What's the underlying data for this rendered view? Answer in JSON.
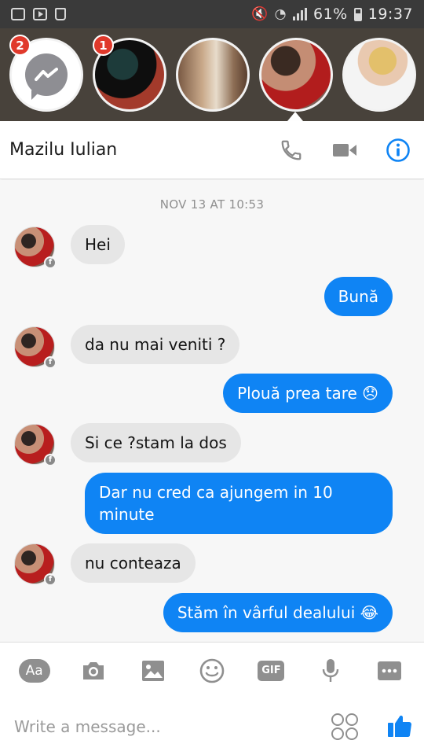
{
  "status_bar": {
    "battery": "61%",
    "time": "19:37",
    "left_icons": [
      "gallery-icon",
      "youtube-icon",
      "recycle-icon"
    ],
    "right_icons": [
      "mute-icon",
      "wifi-icon",
      "signal-icon",
      "battery-icon"
    ]
  },
  "chat_heads": [
    {
      "name": "messenger",
      "badge": "2"
    },
    {
      "name": "contact-1",
      "badge": "1"
    },
    {
      "name": "contact-2",
      "badge": ""
    },
    {
      "name": "contact-3",
      "badge": ""
    },
    {
      "name": "contact-4",
      "badge": ""
    }
  ],
  "header": {
    "title": "Mazilu Iulian",
    "icons": [
      "phone-icon",
      "video-camera-icon",
      "info-icon"
    ]
  },
  "conversation": {
    "timestamp": "NOV 13 AT 10:53",
    "messages": [
      {
        "from": "them",
        "text": "Hei"
      },
      {
        "from": "me",
        "text": "Bună"
      },
      {
        "from": "them",
        "text": "da nu mai veniti ?"
      },
      {
        "from": "me",
        "text": "Plouă prea tare 😞"
      },
      {
        "from": "them",
        "text": "Si ce ?stam la dos"
      },
      {
        "from": "me",
        "text": "Dar nu cred ca ajungem in 10 minute"
      },
      {
        "from": "them",
        "text": "nu conteaza"
      },
      {
        "from": "me",
        "text": "Stăm în vârful dealului 😂"
      }
    ]
  },
  "toolbar": {
    "aa_label": "Aa",
    "gif_label": "GIF",
    "icons": [
      "text-style-icon",
      "camera-icon",
      "image-icon",
      "smiley-icon",
      "gif-icon",
      "microphone-icon",
      "more-icon"
    ]
  },
  "composer": {
    "placeholder": "Write a message...",
    "value": "",
    "icons": [
      "stickers-icon",
      "thumbs-up-icon"
    ]
  },
  "colors": {
    "accent": "#0f84f4",
    "incoming_bubble": "#e6e6e6",
    "heads_background": "#48423b",
    "badge": "#e0392b"
  }
}
